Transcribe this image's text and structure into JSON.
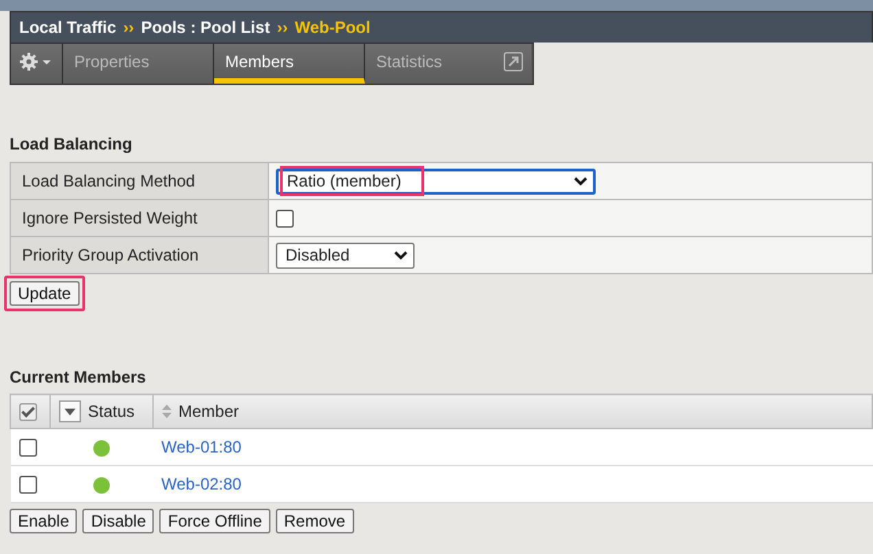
{
  "breadcrumb": {
    "items": [
      "Local Traffic",
      "Pools : Pool List"
    ],
    "separator": "››",
    "current": "Web-Pool"
  },
  "tabs": [
    {
      "label": "Properties",
      "selected": false,
      "external": false
    },
    {
      "label": "Members",
      "selected": true,
      "external": false
    },
    {
      "label": "Statistics",
      "selected": false,
      "external": true
    }
  ],
  "load_balancing": {
    "title": "Load Balancing",
    "rows": [
      {
        "kind": "select",
        "label": "Load Balancing Method",
        "value": "Ratio (member)",
        "wide": true,
        "focused": true,
        "highlighted": true
      },
      {
        "kind": "checkbox",
        "label": "Ignore Persisted Weight",
        "checked": false
      },
      {
        "kind": "select",
        "label": "Priority Group Activation",
        "value": "Disabled",
        "wide": false,
        "focused": false,
        "highlighted": false
      }
    ],
    "update_button": {
      "label": "Update",
      "highlighted": true
    }
  },
  "members": {
    "title": "Current Members",
    "select_all_checked": true,
    "columns": [
      "Status",
      "Member"
    ],
    "rows": [
      {
        "checked": false,
        "color": "#7cc13a",
        "member": "Web-01:80"
      },
      {
        "checked": false,
        "color": "#7cc13a",
        "member": "Web-02:80"
      }
    ],
    "buttons": [
      "Enable",
      "Disable",
      "Force Offline",
      "Remove"
    ]
  }
}
